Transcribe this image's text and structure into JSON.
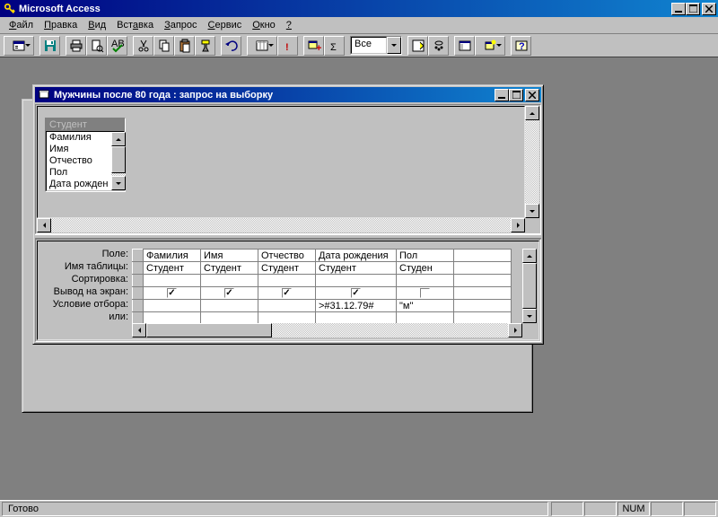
{
  "app": {
    "title": "Microsoft Access"
  },
  "menu": {
    "items": [
      {
        "label": "Файл",
        "u": 0
      },
      {
        "label": "Правка",
        "u": 0
      },
      {
        "label": "Вид",
        "u": 0
      },
      {
        "label": "Вставка",
        "u": 3
      },
      {
        "label": "Запрос",
        "u": 0
      },
      {
        "label": "Сервис",
        "u": 0
      },
      {
        "label": "Окно",
        "u": 0
      },
      {
        "label": "?",
        "u": 0
      }
    ]
  },
  "toolbar": {
    "combo_value": "Все"
  },
  "child": {
    "title": "Мужчины после 80 года : запрос на выборку",
    "table": {
      "name": "Студент",
      "fields": [
        "Фамилия",
        "Имя",
        "Отчество",
        "Пол",
        "Дата рожден"
      ]
    }
  },
  "qbe": {
    "labels": {
      "field": "Поле:",
      "table": "Имя таблицы:",
      "sort": "Сортировка:",
      "show": "Вывод на экран:",
      "criteria": "Условие отбора:",
      "or": "или:"
    },
    "cols": [
      {
        "field": "Фамилия",
        "table": "Студент",
        "show": true,
        "criteria": "",
        "wide": false
      },
      {
        "field": "Имя",
        "table": "Студент",
        "show": true,
        "criteria": "",
        "wide": false
      },
      {
        "field": "Отчество",
        "table": "Студент",
        "show": true,
        "criteria": "",
        "wide": false
      },
      {
        "field": "Дата рождения",
        "table": "Студент",
        "show": true,
        "criteria": ">#31.12.79#",
        "wide": true
      },
      {
        "field": "Пол",
        "table": "Студен",
        "show": false,
        "criteria": "\"м\"",
        "wide": false
      },
      {
        "field": "",
        "table": "",
        "show": false,
        "criteria": "",
        "wide": false,
        "empty": true
      }
    ]
  },
  "status": {
    "ready": "Готово",
    "num": "NUM"
  }
}
